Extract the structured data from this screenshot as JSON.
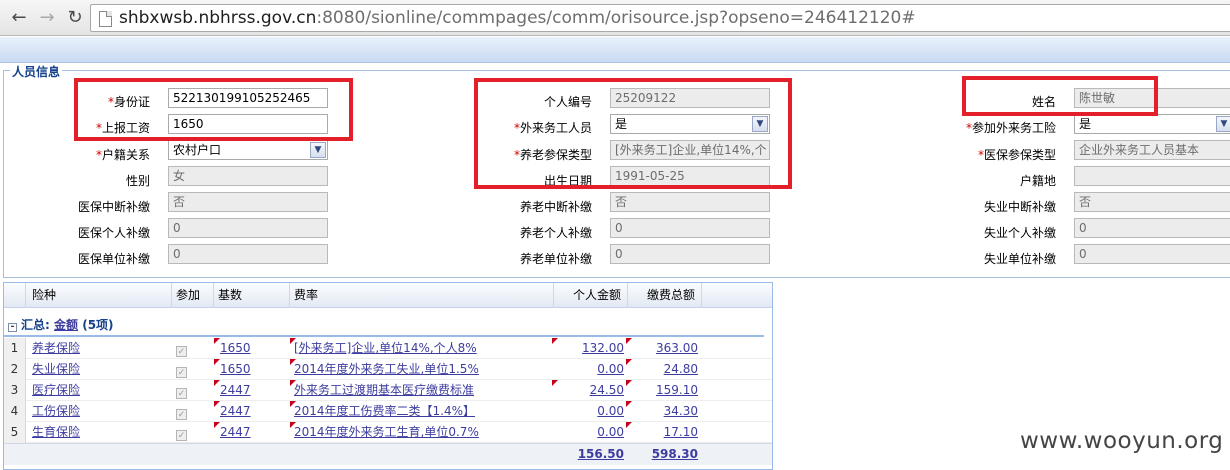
{
  "browser": {
    "url_prefix": "shbxwsb.nbhrss.gov.cn",
    "url_rest": ":8080/sionline/commpages/comm/orisource.jsp?opseno=246412120#"
  },
  "section": {
    "legend": "人员信息"
  },
  "form": {
    "id_card": {
      "label": "身份证",
      "value": "522130199105252465"
    },
    "wage": {
      "label": "上报工资",
      "value": "1650"
    },
    "household": {
      "label": "户籍关系",
      "value": "农村户口"
    },
    "gender": {
      "label": "性别",
      "value": "女"
    },
    "med_interrupt": {
      "label": "医保中断补缴",
      "value": "否"
    },
    "med_personal": {
      "label": "医保个人补缴",
      "value": "0"
    },
    "med_unit": {
      "label": "医保单位补缴",
      "value": "0"
    },
    "person_no": {
      "label": "个人编号",
      "value": "25209122"
    },
    "migrant": {
      "label": "外来务工人员",
      "value": "是"
    },
    "pension_type": {
      "label": "养老参保类型",
      "value": "[外来务工]企业,单位14%,个"
    },
    "birth_date": {
      "label": "出生日期",
      "value": "1991-05-25"
    },
    "pen_interrupt": {
      "label": "养老中断补缴",
      "value": "否"
    },
    "pen_personal": {
      "label": "养老个人补缴",
      "value": "0"
    },
    "pen_unit": {
      "label": "养老单位补缴",
      "value": "0"
    },
    "name": {
      "label": "姓名",
      "value": "陈世敏"
    },
    "join_migrant": {
      "label": "参加外来务工险",
      "value": "是"
    },
    "med_type": {
      "label": "医保参保类型",
      "value": "企业外来务工人员基本"
    },
    "hukou_place": {
      "label": "户籍地",
      "value": ""
    },
    "unemp_interrupt": {
      "label": "失业中断补缴",
      "value": "否"
    },
    "unemp_personal": {
      "label": "失业个人补缴",
      "value": "0"
    },
    "unemp_unit": {
      "label": "失业单位补缴",
      "value": "0"
    }
  },
  "grid": {
    "headers": {
      "type": "险种",
      "join": "参加",
      "base": "基数",
      "rate": "费率",
      "personal": "个人金额",
      "total": "缴费总额"
    },
    "group": {
      "prefix": "汇总:",
      "link": "金额",
      "count": "(5项)"
    },
    "rows": [
      {
        "no": "1",
        "type": "养老保险",
        "check": "✓",
        "base": "1650",
        "rate": "[外来务工]企业,单位14%,个人8%",
        "personal": "132.00",
        "total": "363.00"
      },
      {
        "no": "2",
        "type": "失业保险",
        "check": "✓",
        "base": "1650",
        "rate": "2014年度外来务工失业,单位1.5%",
        "personal": "0.00",
        "total": "24.80"
      },
      {
        "no": "3",
        "type": "医疗保险",
        "check": "✓",
        "base": "2447",
        "rate": "外来务工过渡期基本医疗缴费标准",
        "personal": "24.50",
        "total": "159.10"
      },
      {
        "no": "4",
        "type": "工伤保险",
        "check": "✓",
        "base": "2447",
        "rate": "2014年度工伤费率二类【1.4%】",
        "personal": "0.00",
        "total": "34.30"
      },
      {
        "no": "5",
        "type": "生育保险",
        "check": "✓",
        "base": "2447",
        "rate": "2014年度外来务工生育,单位0.7%",
        "personal": "0.00",
        "total": "17.10"
      }
    ],
    "sum": {
      "personal": "156.50",
      "total": "598.30"
    }
  },
  "watermark": "www.wooyun.org",
  "colors": {
    "highlight_box": "#e3202a",
    "header_blue": "#15428b",
    "link": "#3d3da0"
  }
}
